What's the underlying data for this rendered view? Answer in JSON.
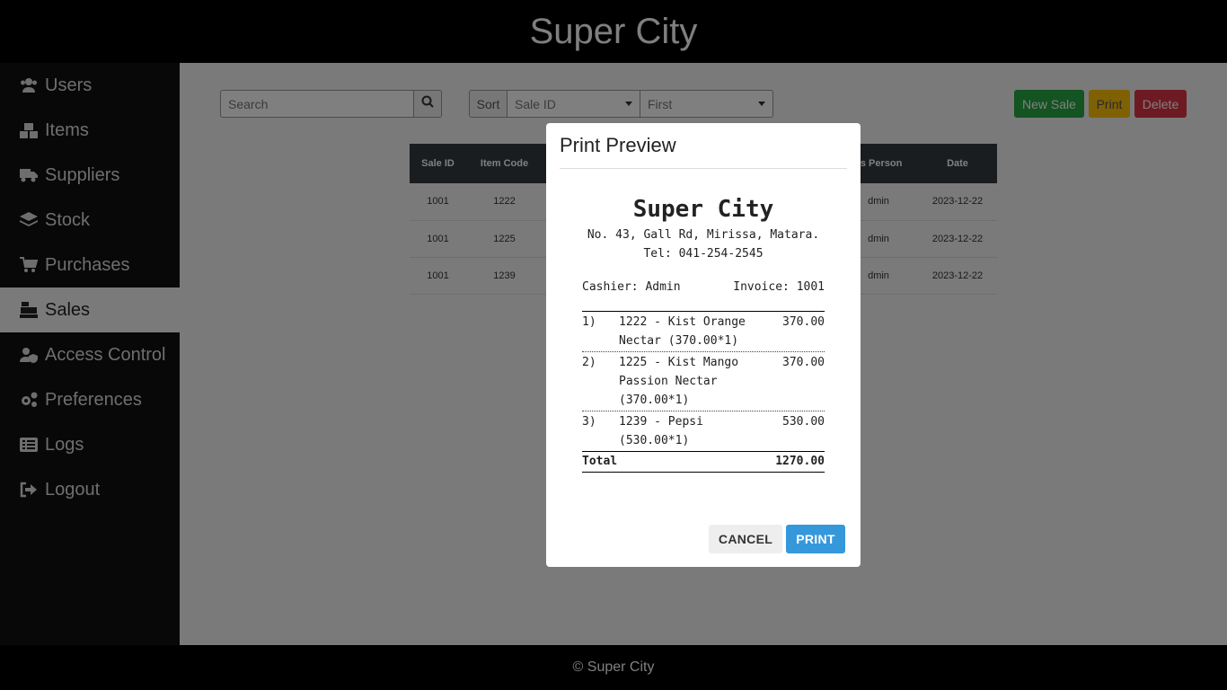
{
  "app": {
    "title": "Super City",
    "footer": "© Super City"
  },
  "sidebar": {
    "items": [
      {
        "label": "Users",
        "icon": "users-icon"
      },
      {
        "label": "Items",
        "icon": "boxes-icon"
      },
      {
        "label": "Suppliers",
        "icon": "truck-icon"
      },
      {
        "label": "Stock",
        "icon": "layers-icon"
      },
      {
        "label": "Purchases",
        "icon": "cart-icon"
      },
      {
        "label": "Sales",
        "icon": "cash-register-icon",
        "active": true
      },
      {
        "label": "Access Control",
        "icon": "user-shield-icon"
      },
      {
        "label": "Preferences",
        "icon": "gears-icon"
      },
      {
        "label": "Logs",
        "icon": "list-icon"
      },
      {
        "label": "Logout",
        "icon": "sign-out-icon"
      }
    ]
  },
  "toolbar": {
    "search_placeholder": "Search",
    "sort_label": "Sort",
    "sort_field": "Sale ID",
    "sort_order": "First",
    "new_sale": "New Sale",
    "print": "Print",
    "delete": "Delete"
  },
  "table": {
    "headers": [
      "Sale ID",
      "Item Code",
      "",
      "",
      "",
      "es Person",
      "Date"
    ],
    "rows": [
      [
        "1001",
        "1222",
        "",
        "",
        "",
        "dmin",
        "2023-12-22"
      ],
      [
        "1001",
        "1225",
        "",
        "",
        "",
        "dmin",
        "2023-12-22"
      ],
      [
        "1001",
        "1239",
        "",
        "",
        "",
        "dmin",
        "2023-12-22"
      ]
    ]
  },
  "modal": {
    "title": "Print Preview",
    "receipt": {
      "store": "Super City",
      "address": "No. 43, Gall Rd, Mirissa, Matara.",
      "tel": "Tel: 041-254-2545",
      "cashier": "Cashier: Admin",
      "invoice": "Invoice: 1001",
      "items": [
        {
          "no": "1)",
          "desc": "1222 - Kist Orange Nectar (370.00*1)",
          "amount": "370.00"
        },
        {
          "no": "2)",
          "desc": "1225 - Kist Mango Passion Nectar (370.00*1)",
          "amount": "370.00"
        },
        {
          "no": "3)",
          "desc": "1239 - Pepsi (530.00*1)",
          "amount": "530.00"
        }
      ],
      "total_label": "Total",
      "total": "1270.00"
    },
    "cancel": "CANCEL",
    "print": "PRINT"
  },
  "colors": {
    "new_sale": "#28a745",
    "print": "#ffc107",
    "delete": "#dc3545",
    "modal_print": "#3498db"
  }
}
